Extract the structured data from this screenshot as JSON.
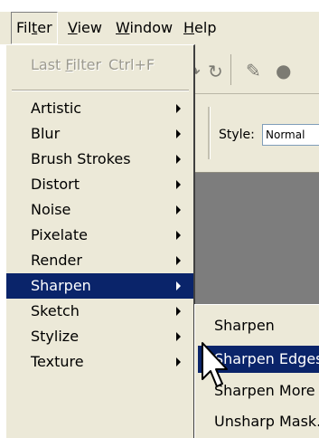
{
  "menubar": {
    "items": [
      {
        "pre": "Fil",
        "key": "t",
        "post": "er"
      },
      {
        "pre": "",
        "key": "V",
        "post": "iew"
      },
      {
        "pre": "",
        "key": "W",
        "post": "indow"
      },
      {
        "pre": "",
        "key": "H",
        "post": "elp"
      }
    ]
  },
  "options": {
    "style_label": "Style:",
    "style_value": "Normal"
  },
  "filter_menu": {
    "last_filter": {
      "pre": "Last ",
      "key": "F",
      "post": "ilter",
      "shortcut": "Ctrl+F"
    },
    "items": [
      "Artistic",
      "Blur",
      "Brush Strokes",
      "Distort",
      "Noise",
      "Pixelate",
      "Render",
      "Sharpen",
      "Sketch",
      "Stylize",
      "Texture"
    ],
    "selected": "Sharpen"
  },
  "sharpen_submenu": {
    "items": [
      "Sharpen",
      "Sharpen Edges",
      "Sharpen More",
      "Unsharp Mask..."
    ],
    "selected": "Sharpen Edges"
  },
  "colors": {
    "menu_bg": "#ece9d8",
    "highlight": "#0a246a",
    "canvas": "#7d7d7d"
  }
}
